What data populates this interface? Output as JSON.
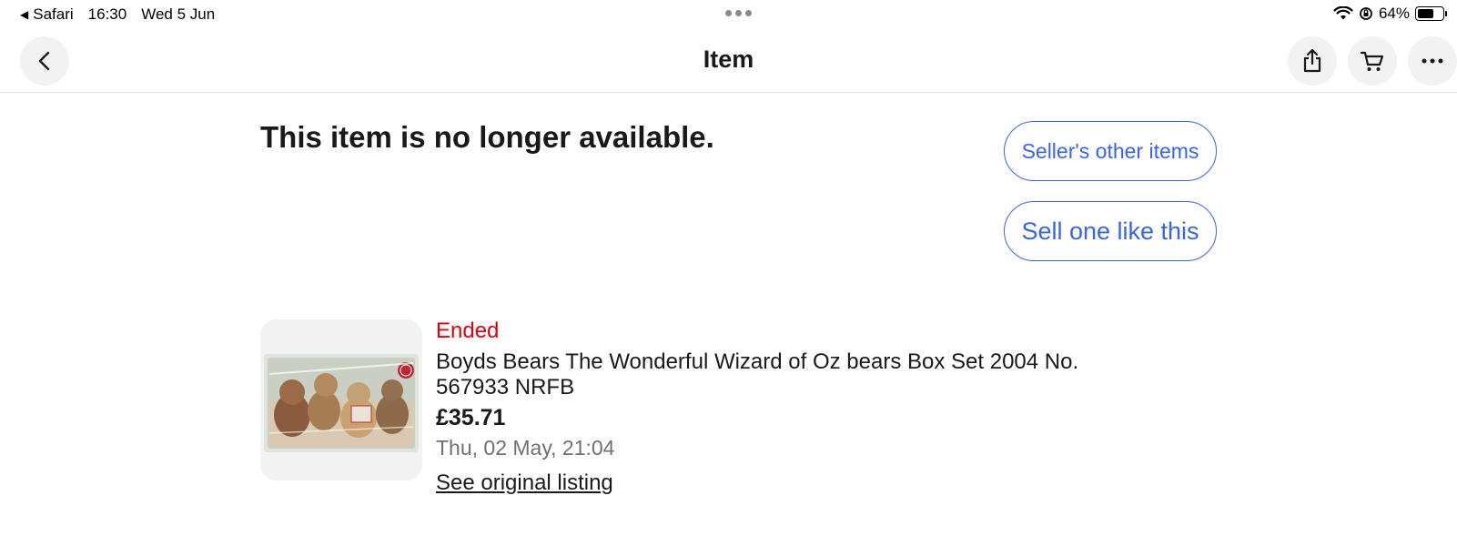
{
  "status_bar": {
    "back_app": "Safari",
    "time": "16:30",
    "date": "Wed 5 Jun",
    "battery_percent": "64%",
    "battery_level": 0.64
  },
  "nav": {
    "title": "Item",
    "icons": [
      "chevron-left-icon",
      "share-icon",
      "cart-icon",
      "more-icon"
    ]
  },
  "content": {
    "headline": "This item is no longer available.",
    "sellers_other_items": "Seller's other items",
    "sell_one_like_this": "Sell one like this"
  },
  "listing": {
    "status": "Ended",
    "title": "Boyds Bears The Wonderful Wizard of Oz bears Box Set 2004 No. 567933 NRFB",
    "price": "£35.71",
    "end_date": "Thu, 02 May, 21:04",
    "link_label": "See original listing"
  },
  "colors": {
    "accent": "#3665f3",
    "ended": "#e0000b",
    "text": "#191919",
    "muted": "#707070"
  }
}
